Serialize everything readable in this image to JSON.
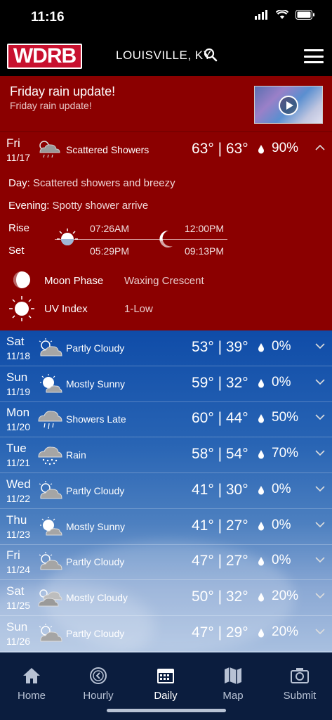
{
  "status_bar": {
    "time": "11:16"
  },
  "header": {
    "logo": "WDRB",
    "location": "LOUISVILLE, KY"
  },
  "alert": {
    "title": "Friday rain update!",
    "subtitle": "Friday rain update!"
  },
  "today": {
    "day": "Fri",
    "date": "11/17",
    "condition": "Scattered Showers",
    "temps": "63° | 63°",
    "precip": "90%",
    "day_label": "Day:",
    "day_text": "Scattered showers and breezy",
    "evening_label": "Evening:",
    "evening_text": "Spotty shower arrive",
    "rise_label": "Rise",
    "set_label": "Set",
    "sunrise": "07:26AM",
    "sunset": "05:29PM",
    "moonrise": "12:00PM",
    "moonset": "09:13PM",
    "moon_phase_label": "Moon Phase",
    "moon_phase": "Waxing Crescent",
    "uv_label": "UV Index",
    "uv": "1-Low"
  },
  "forecast": [
    {
      "day": "Sat",
      "date": "11/18",
      "icon": "partly-cloudy-icon",
      "condition": "Partly Cloudy",
      "temps": "53° | 39°",
      "precip": "0%"
    },
    {
      "day": "Sun",
      "date": "11/19",
      "icon": "mostly-sunny-icon",
      "condition": "Mostly Sunny",
      "temps": "59° | 32°",
      "precip": "0%"
    },
    {
      "day": "Mon",
      "date": "11/20",
      "icon": "showers-icon",
      "condition": "Showers Late",
      "temps": "60° | 44°",
      "precip": "50%"
    },
    {
      "day": "Tue",
      "date": "11/21",
      "icon": "rain-icon",
      "condition": "Rain",
      "temps": "58° | 54°",
      "precip": "70%"
    },
    {
      "day": "Wed",
      "date": "11/22",
      "icon": "partly-cloudy-icon",
      "condition": "Partly Cloudy",
      "temps": "41° | 30°",
      "precip": "0%"
    },
    {
      "day": "Thu",
      "date": "11/23",
      "icon": "mostly-sunny-icon",
      "condition": "Mostly Sunny",
      "temps": "41° | 27°",
      "precip": "0%"
    },
    {
      "day": "Fri",
      "date": "11/24",
      "icon": "partly-cloudy-icon",
      "condition": "Partly Cloudy",
      "temps": "47° | 27°",
      "precip": "0%"
    },
    {
      "day": "Sat",
      "date": "11/25",
      "icon": "mostly-cloudy-icon",
      "condition": "Mostly Cloudy",
      "temps": "50° | 32°",
      "precip": "20%"
    },
    {
      "day": "Sun",
      "date": "11/26",
      "icon": "partly-cloudy-icon",
      "condition": "Partly Cloudy",
      "temps": "47° | 29°",
      "precip": "20%"
    }
  ],
  "tabs": [
    {
      "label": "Home",
      "icon": "house-icon"
    },
    {
      "label": "Hourly",
      "icon": "clock-back-icon"
    },
    {
      "label": "Daily",
      "icon": "calendar-icon"
    },
    {
      "label": "Map",
      "icon": "map-icon"
    },
    {
      "label": "Submit",
      "icon": "camera-icon"
    }
  ],
  "colors": {
    "alert_red": "#8b0000",
    "tab_bg": "#0b1d3e",
    "logo_red": "#c8102e"
  }
}
